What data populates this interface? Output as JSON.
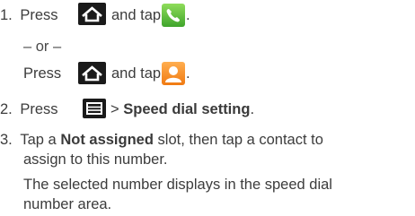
{
  "steps": {
    "s1": {
      "num": "1.",
      "press": "Press",
      "and_tap": "and tap",
      "end": "."
    },
    "or": "– or –",
    "s1b": {
      "press": "Press",
      "and_tap": "and tap",
      "end": "."
    },
    "s2": {
      "num": "2.",
      "press": "Press",
      "gt": ">",
      "target": "Speed dial setting",
      "end": "."
    },
    "s3": {
      "num": "3.",
      "tap": "Tap a",
      "slot": "Not assigned",
      "rest1": " slot, then tap a contact to",
      "rest2": "assign to this number."
    },
    "note": {
      "line1": "The selected number displays in the speed dial",
      "line2": "number area."
    }
  },
  "icons": {
    "home": "home-key-icon",
    "phone": "phone-app-icon",
    "contacts": "contacts-app-icon",
    "menu": "menu-key-icon"
  },
  "colors": {
    "key_bg": "#1a1a1a",
    "phone_green": "#4db33a",
    "contacts_orange": "#f28a1c",
    "text": "#3c3c3c"
  }
}
